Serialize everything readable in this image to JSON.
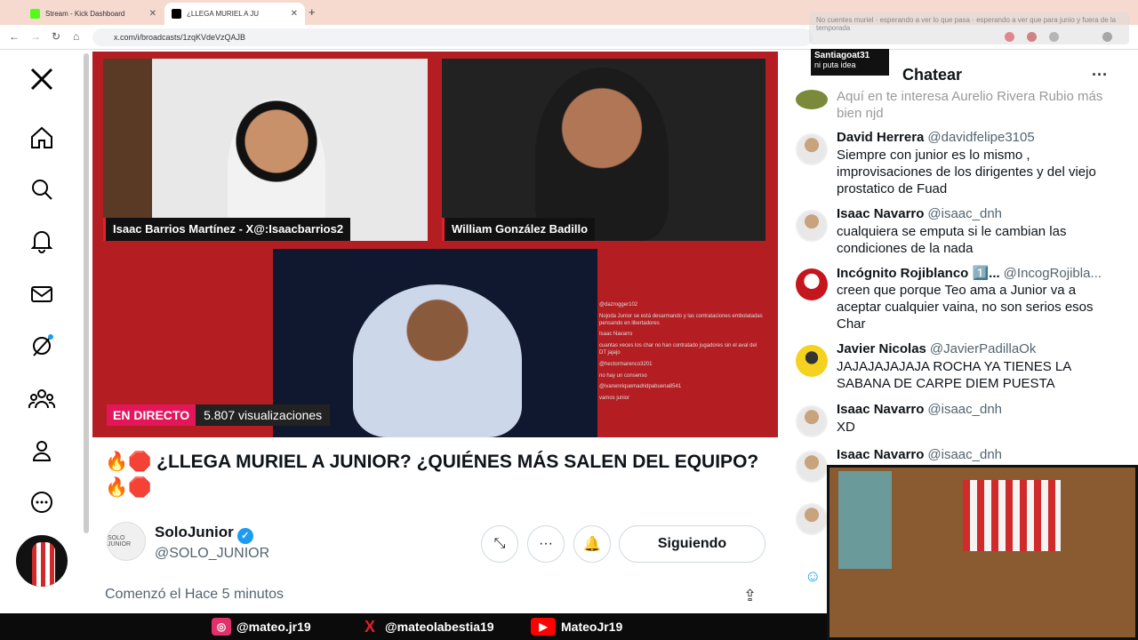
{
  "browser": {
    "tabs": [
      {
        "title": "Stream - Kick Dashboard",
        "favicon_color": "#53fc18"
      },
      {
        "title": "¿LLEGA MURIEL A JU",
        "favicon_color": "#000000"
      }
    ],
    "url": "x.com/i/broadcasts/1zqKVdeVzQAJB",
    "overlay_text": "No cuentes muriel · esperando a ver lo que pasa · esperando a ver que para junio y fuera de la temporada"
  },
  "broadcast": {
    "cams": [
      {
        "name": "Isaac Barrios Martínez - X@:Isaacbarrios2"
      },
      {
        "name": "William González Badillo"
      }
    ],
    "mini_chat": [
      "@dazrogger102",
      "Nojoda Junior se está desarmando y las contrataciones embolatadas pensando en libertadores",
      "Isaac Navarro",
      "cuantas veces los char no han contratado jugadores sin el aval del DT jajajo",
      "@hectormarenco3201",
      "no hay un consenso",
      "@ivanenriquemadridpabuena8541",
      "vamos junior"
    ],
    "live_label": "EN DIRECTO",
    "views": "5.807 visualizaciones"
  },
  "post": {
    "title": "🔥🛑 ¿LLEGA MURIEL A JUNIOR? ¿QUIÉNES MÁS SALEN DEL EQUIPO? 🔥🛑",
    "author_name": "SoloJunior",
    "author_handle": "@SOLO_JUNIOR",
    "avatar_text": "SOLO JUNIOR",
    "follow_label": "Siguiendo",
    "started": "Comenzó el Hace 5 minutos"
  },
  "chat": {
    "header": "Chatear",
    "partial_text": "Aquí en te interesa Aurelio Rivera Rubio más bien njd",
    "messages": [
      {
        "name": "David Herrera",
        "handle": "@davidfelipe3105",
        "text": "Siempre con junior es lo mismo , improvisaciones  de los dirigentes y del viejo prostatico de Fuad"
      },
      {
        "name": "Isaac Navarro",
        "handle": "@isaac_dnh",
        "text": "cualquiera se emputa si le cambian las condiciones de la nada"
      },
      {
        "name": "Incógnito Rojiblanco 1️⃣...",
        "handle": "@IncogRojibla...",
        "text": "creen que porque Teo ama a Junior va a aceptar cualquier vaina, no son serios esos Char"
      },
      {
        "name": "Javier Nicolas",
        "handle": "@JavierPadillaOk",
        "text": "JAJAJAJAJAJA ROCHA YA TIENES LA SABANA DE CARPE DIEM PUESTA"
      },
      {
        "name": "Isaac Navarro",
        "handle": "@isaac_dnh",
        "text": "XD"
      },
      {
        "name": "Isaac Navarro",
        "handle": "@isaac_dnh",
        "text": ""
      }
    ]
  },
  "stream_overlay": {
    "viewer_name": "Santiagoat31",
    "viewer_msg": "ni puta idea",
    "socials": [
      {
        "icon": "instagram-icon",
        "handle": "@mateo.jr19",
        "color": "#e1306c"
      },
      {
        "icon": "x-icon",
        "handle": "@mateolabestia19",
        "color": "#e1202b"
      },
      {
        "icon": "youtube-icon",
        "handle": "MateoJr19",
        "color": "#ff0000"
      }
    ]
  }
}
